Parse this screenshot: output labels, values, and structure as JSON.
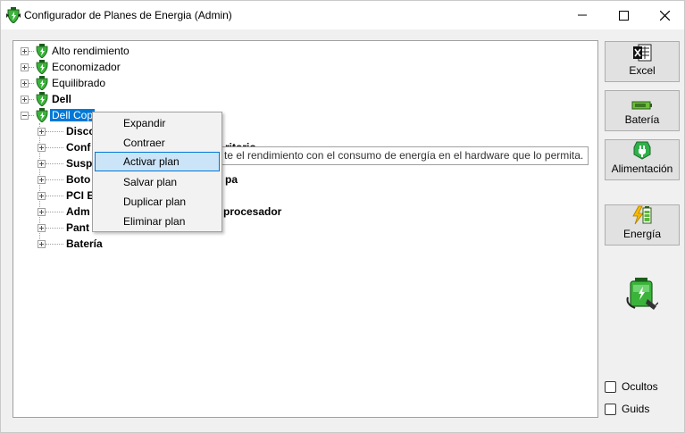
{
  "window": {
    "title": "Configurador de Planes de Energia (Admin)",
    "controls": [
      "minimize",
      "maximize",
      "close"
    ]
  },
  "tree": {
    "plans": [
      {
        "label": "Alto rendimiento",
        "bold": false
      },
      {
        "label": "Economizador",
        "bold": false
      },
      {
        "label": "Equilibrado",
        "bold": false
      },
      {
        "label": "Dell",
        "bold": true
      },
      {
        "label": "Dell Copia",
        "bold": false,
        "selected": true,
        "expanded": true
      }
    ],
    "selected_visible_label": "Dell Cop",
    "children": [
      {
        "label": "Disco"
      },
      {
        "label": "Conf",
        "label_right": "ritorio"
      },
      {
        "label": "Susp"
      },
      {
        "label": "Boto",
        "label_right": "pa"
      },
      {
        "label": "PCI E"
      },
      {
        "label": "Adm",
        "label_right": "procesador"
      },
      {
        "label": "Pant"
      },
      {
        "label": "Batería"
      }
    ]
  },
  "tooltip": {
    "text": "te el rendimiento con el consumo de energía en el hardware que lo permita."
  },
  "context_menu": {
    "items": [
      "Expandir",
      "Contraer",
      "Activar plan",
      "Salvar plan",
      "Duplicar plan",
      "Eliminar plan"
    ],
    "highlighted": "Activar plan"
  },
  "side_buttons": {
    "excel": "Excel",
    "bateria": "Batería",
    "alimentacion": "Alimentación",
    "energia": "Energía"
  },
  "checkboxes": {
    "ocultos": {
      "label": "Ocultos",
      "checked": false
    },
    "guids": {
      "label": "Guids",
      "checked": false
    }
  },
  "icons": {
    "app": "power-plan-icon",
    "plan": "power-plan-icon",
    "excel": "excel-icon",
    "battery": "battery-icon",
    "plug": "power-plug-icon",
    "energy": "energy-bolt-icon",
    "big": "battery-plug-icon"
  },
  "colors": {
    "selection": "#0078d7",
    "menu_highlight": "#cce4f7",
    "plan_icon_green": "#3bb33b"
  }
}
